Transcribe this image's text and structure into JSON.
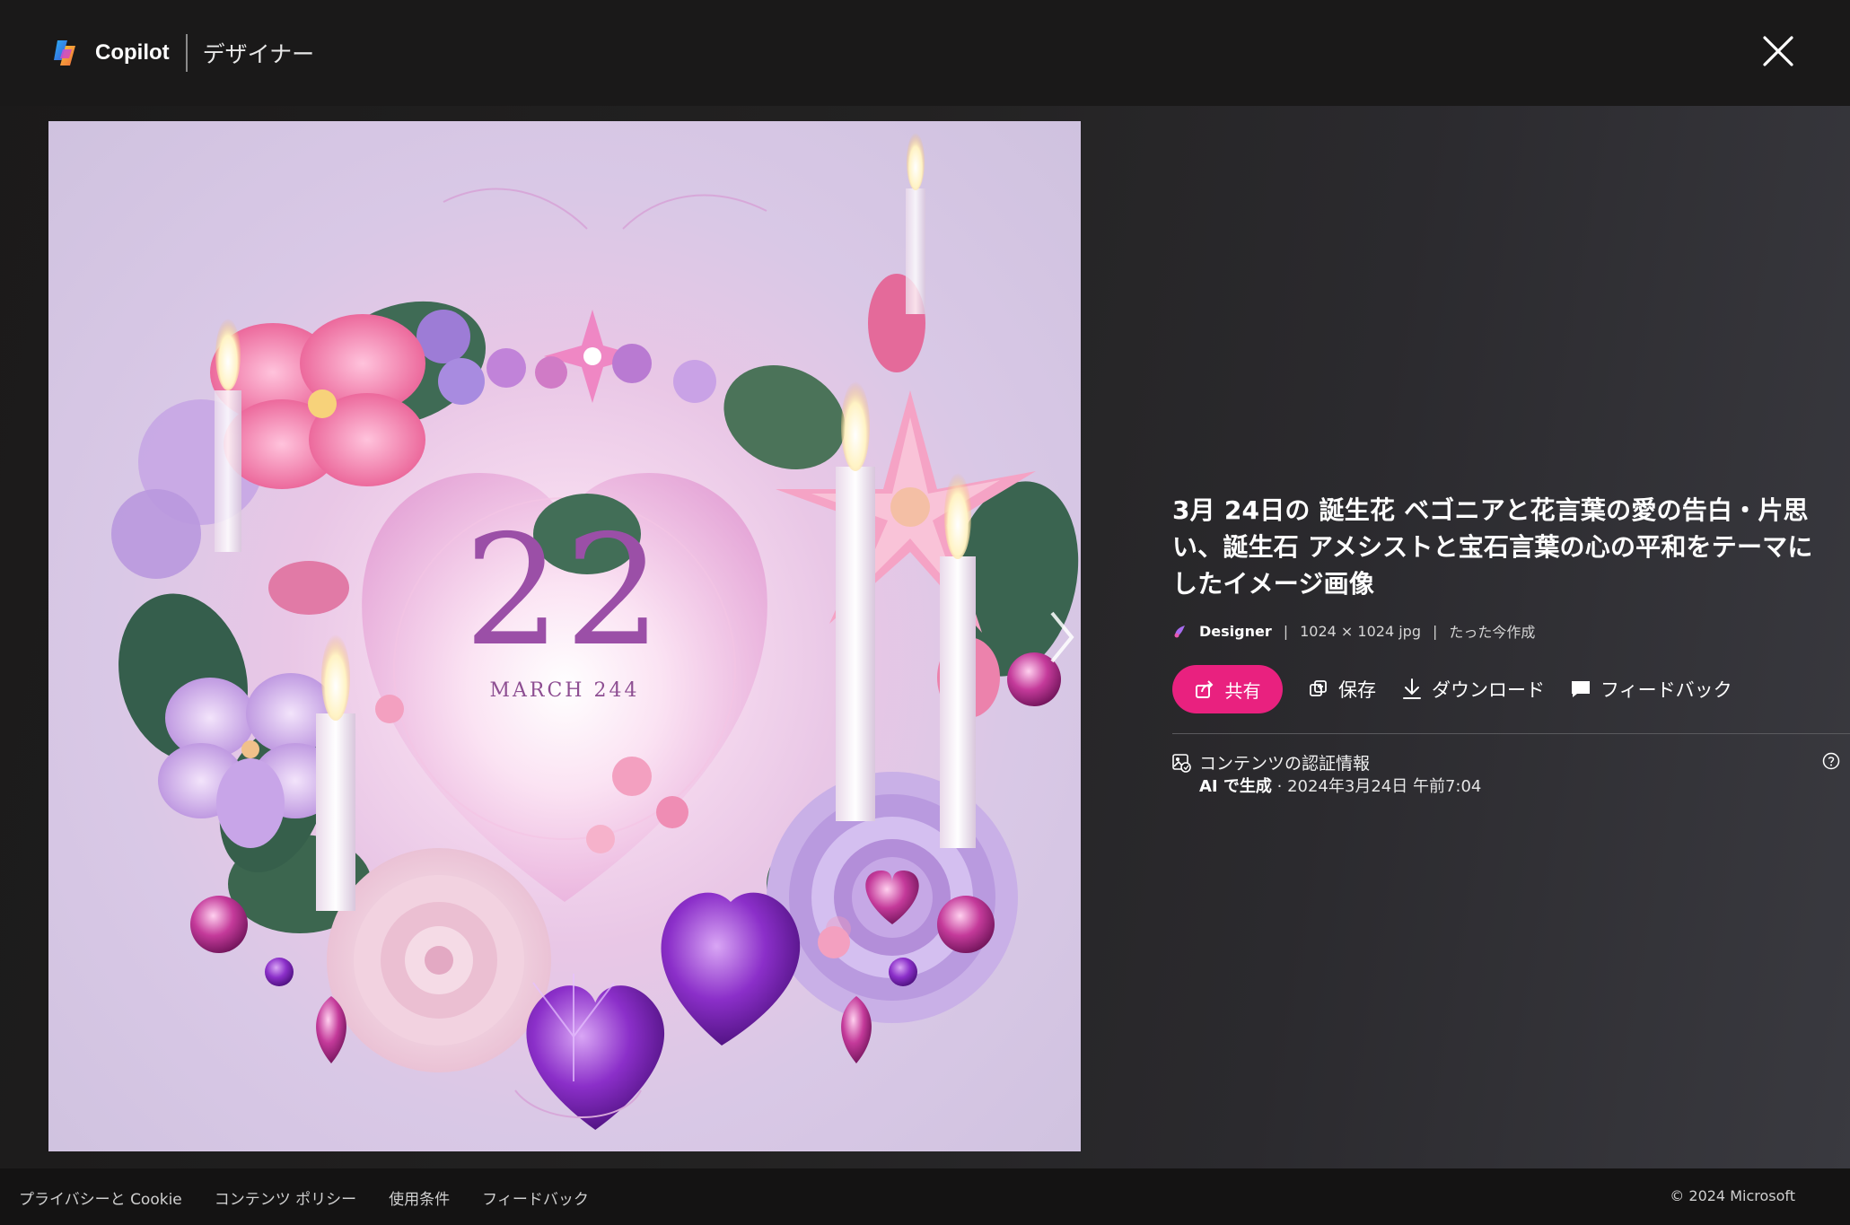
{
  "header": {
    "brand": "Copilot",
    "subtitle": "デザイナー"
  },
  "image": {
    "big_number": "22",
    "caption": "MARCH 244"
  },
  "info": {
    "title": "3月 24日の 誕生花 ベゴニアと花言葉の愛の告白・片思い、誕生石 アメシストと宝石言葉の心の平和をテーマにしたイメージ画像",
    "meta": {
      "source": "Designer",
      "separator": "|",
      "dimensions": "1024 × 1024 jpg",
      "created": "たった今作成"
    },
    "actions": {
      "share": "共有",
      "save": "保存",
      "download": "ダウンロード",
      "feedback": "フィードバック"
    },
    "credentials": {
      "title": "コンテンツの認証情報",
      "ai_label": "AI で生成",
      "date": " · 2024年3月24日 午前7:04"
    }
  },
  "footer": {
    "links": [
      "プライバシーと Cookie",
      "コンテンツ ポリシー",
      "使用条件",
      "フィードバック"
    ],
    "copyright": "© 2024 Microsoft"
  },
  "colors": {
    "accent": "#e9217f",
    "background": "#1b1a1a",
    "footer": "#141313"
  }
}
